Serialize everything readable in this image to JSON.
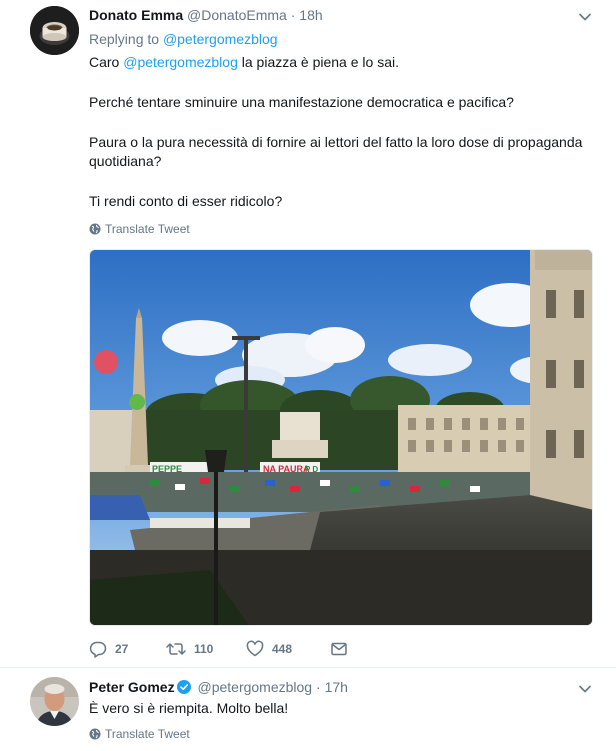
{
  "tweet1": {
    "author_name": "Donato Emma",
    "author_handle": "@DonatoEmma",
    "separator": "·",
    "time": "18h",
    "replying_prefix": "Replying to",
    "replying_handle": "@petergomezblog",
    "line1_prefix": "Caro",
    "line1_mention": "@petergomezblog",
    "line1_suffix": "la piazza è piena e lo sai.",
    "line2": "Perché tentare sminuire una manifestazione democratica e pacifica?",
    "line3": "Paura o la pura necessità di fornire ai lettori del fatto la loro dose di propaganda quotidiana?",
    "line4": "Ti rendi conto di esser ridicolo?",
    "translate_label": "Translate Tweet",
    "media": {
      "banner_left": "PEPPE",
      "banner_center": "NA PAURA",
      "banner_right": "P D"
    },
    "actions": {
      "replies": "27",
      "retweets": "110",
      "likes": "448"
    }
  },
  "tweet2": {
    "author_name": "Peter Gomez",
    "author_handle": "@petergomezblog",
    "separator": "·",
    "time": "17h",
    "text": "È vero si è riempita. Molto bella!",
    "translate_label": "Translate Tweet"
  },
  "colors": {
    "link": "#1da1f2",
    "muted": "#657786",
    "text": "#14171a",
    "verified": "#1da1f2",
    "divider": "#e6ecf0"
  },
  "icons": {
    "reply": "reply-icon",
    "retweet": "retweet-icon",
    "like": "heart-icon",
    "dm": "envelope-icon",
    "caret": "chevron-down-icon",
    "globe": "globe-icon",
    "verified": "verified-badge-icon"
  }
}
